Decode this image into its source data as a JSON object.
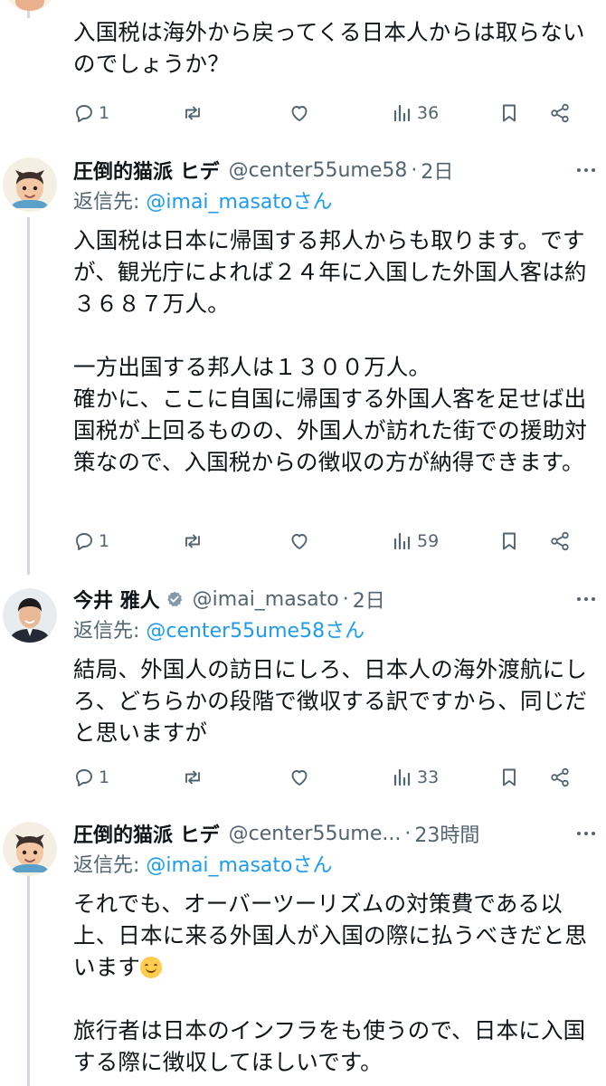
{
  "tweets": [
    {
      "text": "入国税は海外から戻ってくる日本人からは取らないのでしょうか？",
      "stats": {
        "replies": "1",
        "views": "36"
      }
    },
    {
      "name": "圧倒的猫派 ヒデ",
      "handle": "@center55ume58",
      "sep": "·",
      "time": "2日",
      "reply_label": "返信先: ",
      "reply_mention": "@imai_masatoさん",
      "text": "入国税は日本に帰国する邦人からも取ります。ですが、観光庁によれば２４年に入国した外国人客は約３６８７万人。\n\n一方出国する邦人は１３００万人。\n確かに、ここに自国に帰国する外国人客を足せば出国税が上回るものの、外国人が訪れた街での援助対策なので、入国税からの徴収の方が納得できます。",
      "stats": {
        "replies": "1",
        "views": "59"
      }
    },
    {
      "name": "今井 雅人",
      "verified": true,
      "handle": "@imai_masato",
      "sep": "·",
      "time": "2日",
      "reply_label": "返信先: ",
      "reply_mention": "@center55ume58さん",
      "text": "結局、外国人の訪日にしろ、日本人の海外渡航にしろ、どちらかの段階で徴収する訳ですから、同じだと思いますが",
      "stats": {
        "replies": "1",
        "views": "33"
      }
    },
    {
      "name": "圧倒的猫派 ヒデ",
      "handle": "@center55ume...",
      "sep": "·",
      "time": "23時間",
      "reply_label": "返信先: ",
      "reply_mention": "@imai_masatoさん",
      "text_part1": "それでも、オーバーツーリズムの対策費である以上、日本に来る外国人が入国の際に払うべきだと思います",
      "emoji": "smiling-face",
      "text_part2": "\n\n旅行者は日本のインフラをも使うので、日本に入国する際に徴収してほしいです。"
    }
  ],
  "colors": {
    "text": "#0f1419",
    "secondary": "#536471",
    "link": "#1d9bf0",
    "thread_line": "#cfd9de",
    "verified": "#829aab"
  },
  "icons": [
    "reply-icon",
    "retweet-icon",
    "like-icon",
    "views-icon",
    "bookmark-icon",
    "share-icon",
    "more-icon",
    "verified-icon"
  ]
}
